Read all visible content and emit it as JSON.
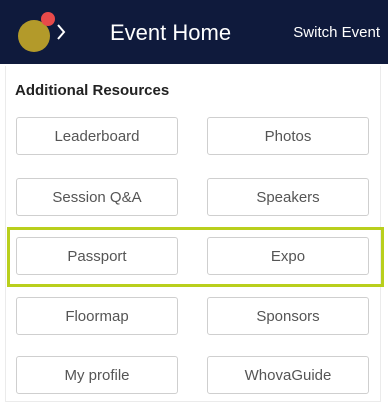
{
  "header": {
    "title": "Event Home",
    "switch_label": "Switch Event",
    "logo_icon": "event-logo-icon",
    "chevron_icon": "chevron-right-icon",
    "colors": {
      "background": "#0f1a3c",
      "logo_big": "#b39a2a",
      "logo_small": "#e84a4a"
    }
  },
  "resources": {
    "title": "Additional Resources",
    "buttons": [
      {
        "label": "Leaderboard"
      },
      {
        "label": "Photos"
      },
      {
        "label": "Session Q&A"
      },
      {
        "label": "Speakers"
      },
      {
        "label": "Passport"
      },
      {
        "label": "Expo"
      },
      {
        "label": "Floormap"
      },
      {
        "label": "Sponsors"
      },
      {
        "label": "My profile"
      },
      {
        "label": "WhovaGuide"
      }
    ],
    "highlight_color": "#b9cf1c"
  }
}
